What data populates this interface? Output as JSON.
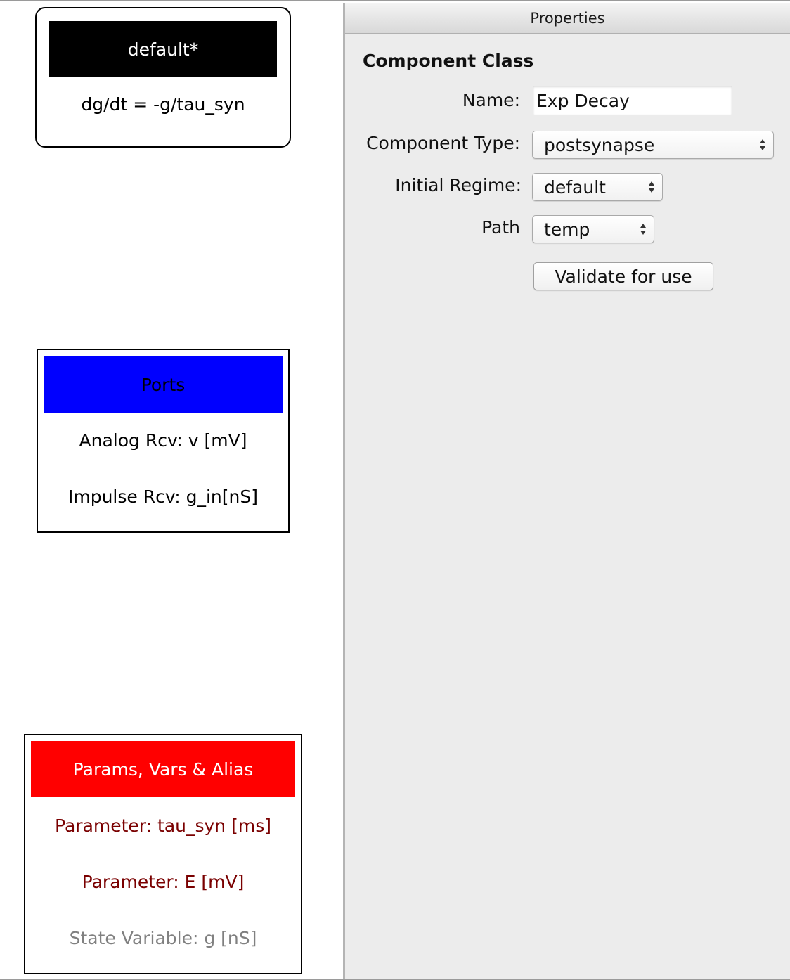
{
  "canvas": {
    "regime_box": {
      "title": "default*",
      "equation": "dg/dt = -g/tau_syn"
    },
    "ports_box": {
      "title": "Ports",
      "items": [
        "Analog Rcv: v [mV]",
        "Impulse Rcv: g_in[nS]"
      ]
    },
    "params_box": {
      "title": "Params, Vars & Alias",
      "items": [
        "Parameter: tau_syn [ms]",
        "Parameter: E [mV]",
        "State Variable: g [nS]"
      ]
    }
  },
  "properties": {
    "panel_title": "Properties",
    "section_title": "Component Class",
    "name_label": "Name:",
    "name_value": "Exp Decay",
    "component_type_label": "Component Type:",
    "component_type_value": "postsynapse",
    "initial_regime_label": "Initial Regime:",
    "initial_regime_value": "default",
    "path_label": "Path",
    "path_value": "temp",
    "validate_label": "Validate for use"
  },
  "colors": {
    "regime_header": "#000000",
    "ports_header": "#0000ff",
    "params_header": "#ff0000",
    "parameter_text": "#7a0000",
    "state_variable_text": "#808080"
  },
  "icons": [
    "select-arrows-icon"
  ]
}
